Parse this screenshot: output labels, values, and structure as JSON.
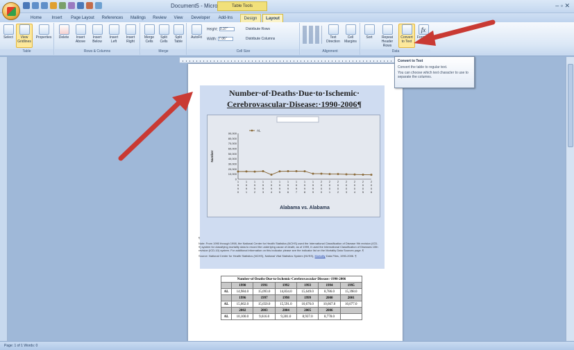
{
  "window": {
    "title": "Document5 - Microsoft Word",
    "context_tab": "Table Tools"
  },
  "tabs": [
    "Home",
    "Insert",
    "Page Layout",
    "References",
    "Mailings",
    "Review",
    "View",
    "Developer",
    "Add-Ins",
    "Design",
    "Layout"
  ],
  "ribbon": {
    "table_group": {
      "label": "Table",
      "buttons": [
        "Select",
        "View Gridlines",
        "Properties"
      ]
    },
    "rows_cols_group": {
      "label": "Rows & Columns",
      "buttons": [
        "Delete",
        "Insert Above",
        "Insert Below",
        "Insert Left",
        "Insert Right"
      ]
    },
    "merge_group": {
      "label": "Merge",
      "buttons": [
        "Merge Cells",
        "Split Cells",
        "Split Table"
      ]
    },
    "cell_size_group": {
      "label": "Cell Size",
      "autofit": "AutoFit",
      "height_label": "Height:",
      "height_value": "0.37\"",
      "width_label": "Width:",
      "width_value": "7.06\"",
      "dist_rows": "Distribute Rows",
      "dist_cols": "Distribute Columns"
    },
    "alignment_group": {
      "label": "Alignment",
      "buttons": [
        "Text Direction",
        "Cell Margins"
      ]
    },
    "data_group": {
      "label": "Data",
      "buttons": [
        "Sort",
        "Repeat Header Rows",
        "Convert to Text",
        "Formula"
      ]
    }
  },
  "tooltip": {
    "title": "Convert to Text",
    "line1": "Convert the table to regular text.",
    "line2": "You can choose which text character to use to separate the columns."
  },
  "document": {
    "title_line1": "Number·of·Deaths·Due·to·Ischemic·",
    "title_line2": "Cerebrovascular·Disease:·1990-2006¶",
    "pilcrow": "¶",
    "note": "Note: From 1990 through 1998, the National Center for Health Statistics (NCHS) used the International Classification of Disease 9th revision (ICD-9) system for classifying mortality data to record the underlying cause of death; as of 1999, it used the International Classification of Diseases 10th revision (ICD-10) system. For additional information on this indicator please see the indicator list on the Mortality Data Sources page. ¶",
    "source_prefix": "Source: National Center for Health Statistics (NCHS), National Vital Statistics System (NVSS), ",
    "source_link": "Mortality",
    "source_suffix": " Data Files, 1990-2006. ¶"
  },
  "chart_data": {
    "type": "line",
    "title": "",
    "xlabel": "Alabama vs. Alabama",
    "ylabel": "Number",
    "legend": "top-left",
    "ylim": [
      0,
      90000
    ],
    "yticks": [
      "90,000",
      "80,000",
      "70,000",
      "60,000",
      "50,000",
      "40,000",
      "30,000",
      "20,000",
      "10,000",
      "0"
    ],
    "categories": [
      "1990",
      "1991",
      "1992",
      "1993",
      "1994",
      "1995",
      "1996",
      "1997",
      "1998",
      "1999",
      "2000",
      "2001",
      "2002",
      "2003",
      "2004",
      "2005",
      "2006"
    ],
    "series": [
      {
        "name": "AL",
        "values": [
          14984,
          15093,
          14834,
          15649,
          8786,
          15398,
          15602,
          15650,
          15591,
          10676,
          10667,
          10077,
          10100,
          9616,
          9281,
          8937,
          8778
        ]
      }
    ]
  },
  "table": {
    "caption": "Number·of·Deaths·Due·to·Ischemic·Cerebrovascular·Disease:·1990-2006",
    "rows": [
      [
        "",
        "1990",
        "1991",
        "1992",
        "1993",
        "1994",
        "1995"
      ],
      [
        "AL",
        "14,984.0",
        "15,093.0",
        "14,834.0",
        "15,649.0",
        "8,786.0",
        "15,398.0"
      ],
      [
        "",
        "1996",
        "1997",
        "1998",
        "1999",
        "2000",
        "2001"
      ],
      [
        "AL",
        "15,602.0",
        "15,650.0",
        "15,591.0",
        "10,676.0",
        "10,667.0",
        "10,077.0"
      ],
      [
        "",
        "2002",
        "2003",
        "2004",
        "2005",
        "2006",
        ""
      ],
      [
        "AL",
        "10,100.0",
        "9,616.0",
        "9,281.0",
        "8,937.0",
        "8,778.0",
        ""
      ]
    ]
  },
  "colors": {
    "arrow": "#c93a33",
    "series": "#8a6a3a",
    "accent": "#fde89a"
  },
  "status": {
    "text": "Page: 1 of 1   Words: 0"
  }
}
